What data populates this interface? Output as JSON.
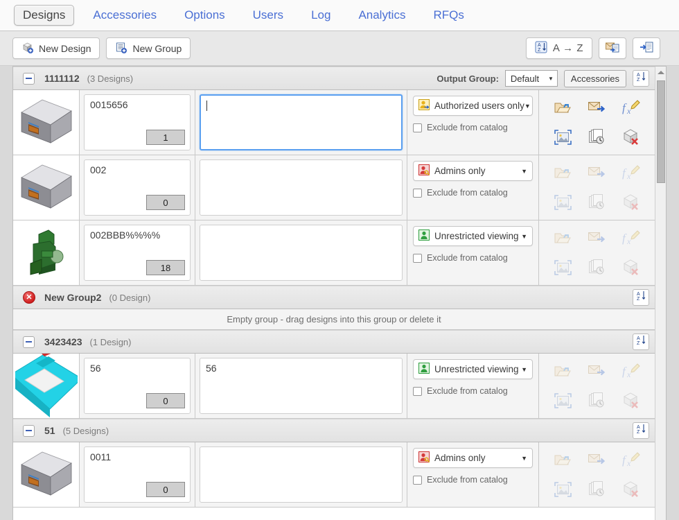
{
  "tabs": [
    {
      "label": "Designs",
      "active": true
    },
    {
      "label": "Accessories",
      "active": false
    },
    {
      "label": "Options",
      "active": false
    },
    {
      "label": "Users",
      "active": false
    },
    {
      "label": "Log",
      "active": false
    },
    {
      "label": "Analytics",
      "active": false
    },
    {
      "label": "RFQs",
      "active": false
    }
  ],
  "toolbar": {
    "new_design_label": "New Design",
    "new_group_label": "New Group",
    "sort_az_label": "A → Z",
    "export_mail_icon": "mail-export-icon",
    "import_icon": "import-list-icon"
  },
  "colors": {
    "tab_link": "#4a6fd4",
    "focus_border": "#5a9ff0",
    "perm_authorized": "#e8b21a",
    "perm_admins": "#d43a3a",
    "perm_unrestricted": "#2f9e3f",
    "delete_red": "#cf1c1c"
  },
  "group_toolbar": {
    "output_group_label": "Output Group:",
    "output_group_value": "Default",
    "accessories_label": "Accessories",
    "sort_icon": "sort-az-icon"
  },
  "empty_group_message": "Empty group - drag designs into this group or delete it",
  "labels": {
    "exclude_from_catalog": "Exclude from catalog"
  },
  "groups": [
    {
      "name": "1111112",
      "count_label": "(3 Designs)",
      "collapsible": true,
      "has_output_toolbar": true,
      "empty": false,
      "rows": [
        {
          "thumb": "grey-box-thumbnail",
          "name": "0015656",
          "qty": "1",
          "description": "",
          "description_focused": true,
          "permission": "Authorized users only",
          "permission_icon": "user-authorized-icon",
          "exclude_checked": false,
          "actions_enabled": true
        },
        {
          "thumb": "grey-box-thumbnail",
          "name": "002",
          "qty": "0",
          "description": "",
          "description_focused": false,
          "permission": "Admins only",
          "permission_icon": "user-admin-key-icon",
          "exclude_checked": false,
          "actions_enabled": false
        },
        {
          "thumb": "green-machine-thumbnail",
          "name": "002BBB%%%%",
          "qty": "18",
          "description": "",
          "description_focused": false,
          "permission": "Unrestricted viewing",
          "permission_icon": "user-unrestricted-icon",
          "exclude_checked": false,
          "actions_enabled": false
        }
      ]
    },
    {
      "name": "New Group2",
      "count_label": "(0 Design)",
      "collapsible": false,
      "has_output_toolbar": false,
      "empty": true,
      "rows": []
    },
    {
      "name": "3423423",
      "count_label": "(1 Design)",
      "collapsible": true,
      "has_output_toolbar": false,
      "empty": false,
      "rows": [
        {
          "thumb": "cyan-part-thumbnail",
          "name": "56",
          "qty": "0",
          "description": "56",
          "description_focused": false,
          "permission": "Unrestricted viewing",
          "permission_icon": "user-unrestricted-icon",
          "exclude_checked": false,
          "actions_enabled": false
        }
      ]
    },
    {
      "name": "51",
      "count_label": "(5 Designs)",
      "collapsible": true,
      "has_output_toolbar": false,
      "empty": false,
      "rows": [
        {
          "thumb": "grey-box-thumbnail",
          "name": "0011",
          "qty": "0",
          "description": "",
          "description_focused": false,
          "permission": "Admins only",
          "permission_icon": "user-admin-key-icon",
          "exclude_checked": false,
          "actions_enabled": false
        }
      ]
    }
  ],
  "action_icons": [
    "open-folder-icon",
    "send-mail-icon",
    "edit-formula-icon",
    "image-frame-icon",
    "revision-history-icon",
    "delete-design-icon"
  ]
}
